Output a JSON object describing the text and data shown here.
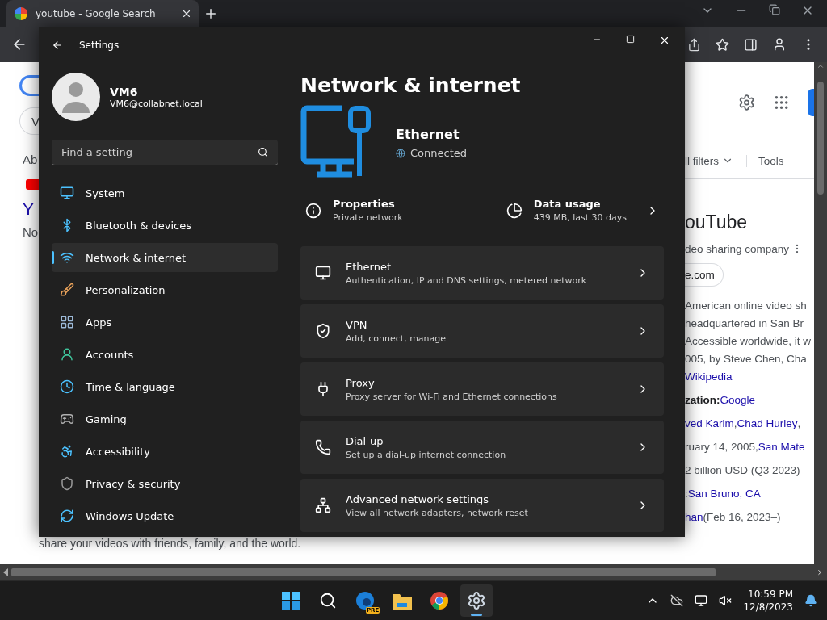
{
  "browser": {
    "tab": {
      "title": "youtube - Google Search",
      "selected": true
    },
    "page": {
      "left": [
        {
          "kind": "text",
          "text": "Ab"
        },
        {
          "kind": "title",
          "text": "Y"
        },
        {
          "kind": "text",
          "text": "No"
        }
      ],
      "left_chip": "V",
      "bottom_text": "share your videos with friends, family, and the world.",
      "filters": "ll filters",
      "tools": "Tools",
      "kp_title": "ouTube",
      "kp_subtitle": "deo sharing company",
      "kp_site": "e.com",
      "kp_lines": [
        [
          {
            "kind": "plain",
            "text": "American online video sh"
          }
        ],
        [
          {
            "kind": "plain",
            "text": "headquartered in San Br"
          }
        ],
        [
          {
            "kind": "plain",
            "text": "Accessible worldwide, it w"
          }
        ],
        [
          {
            "kind": "plain",
            "text": "005, by Steve Chen, Cha"
          }
        ],
        [
          {
            "kind": "link",
            "text": "Wikipedia"
          }
        ],
        [
          {
            "kind": "bold",
            "text": "zation: "
          },
          {
            "kind": "link",
            "text": "Google"
          }
        ],
        [
          {
            "kind": "link",
            "text": "ved Karim"
          },
          {
            "kind": "plain",
            "text": ", "
          },
          {
            "kind": "link",
            "text": "Chad Hurley"
          },
          {
            "kind": "plain",
            "text": ","
          }
        ],
        [
          {
            "kind": "plain",
            "text": "ruary 14, 2005, "
          },
          {
            "kind": "link",
            "text": "San Mate"
          }
        ],
        [
          {
            "kind": "plain",
            "text": "2 billion USD (Q3 2023)"
          }
        ],
        [
          {
            "kind": "plain",
            "text": ": "
          },
          {
            "kind": "link",
            "text": "San Bruno, CA"
          }
        ],
        [
          {
            "kind": "link",
            "text": "han"
          },
          {
            "kind": "plain",
            "text": " (Feb 16, 2023–)"
          }
        ]
      ]
    }
  },
  "settings": {
    "title": "Settings",
    "user": {
      "name": "VM6",
      "email": "VM6@collabnet.local"
    },
    "search": {
      "placeholder": "Find a setting"
    },
    "nav": [
      {
        "label": "System",
        "selected": false
      },
      {
        "label": "Bluetooth & devices",
        "selected": false
      },
      {
        "label": "Network & internet",
        "selected": true
      },
      {
        "label": "Personalization",
        "selected": false
      },
      {
        "label": "Apps",
        "selected": false
      },
      {
        "label": "Accounts",
        "selected": false
      },
      {
        "label": "Time & language",
        "selected": false
      },
      {
        "label": "Gaming",
        "selected": false
      },
      {
        "label": "Accessibility",
        "selected": false
      },
      {
        "label": "Privacy & security",
        "selected": false
      },
      {
        "label": "Windows Update",
        "selected": false
      }
    ],
    "heading": "Network & internet",
    "connection": {
      "name": "Ethernet",
      "status": "Connected"
    },
    "properties": {
      "title": "Properties",
      "subtitle": "Private network"
    },
    "data_usage": {
      "title": "Data usage",
      "subtitle": "439 MB, last 30 days"
    },
    "cards": [
      {
        "title": "Ethernet",
        "subtitle": "Authentication, IP and DNS settings, metered network"
      },
      {
        "title": "VPN",
        "subtitle": "Add, connect, manage"
      },
      {
        "title": "Proxy",
        "subtitle": "Proxy server for Wi-Fi and Ethernet connections"
      },
      {
        "title": "Dial-up",
        "subtitle": "Set up a dial-up internet connection"
      },
      {
        "title": "Advanced network settings",
        "subtitle": "View all network adapters, network reset"
      }
    ]
  },
  "taskbar": {
    "apps": [
      {
        "kind": "start",
        "selected": false
      },
      {
        "kind": "search",
        "selected": false
      },
      {
        "kind": "edge",
        "badge": "PRE",
        "selected": false
      },
      {
        "kind": "files",
        "selected": false
      },
      {
        "kind": "chrome",
        "selected": false
      },
      {
        "kind": "settings",
        "selected": true
      }
    ],
    "time": "10:59 PM",
    "date": "12/8/2023"
  }
}
